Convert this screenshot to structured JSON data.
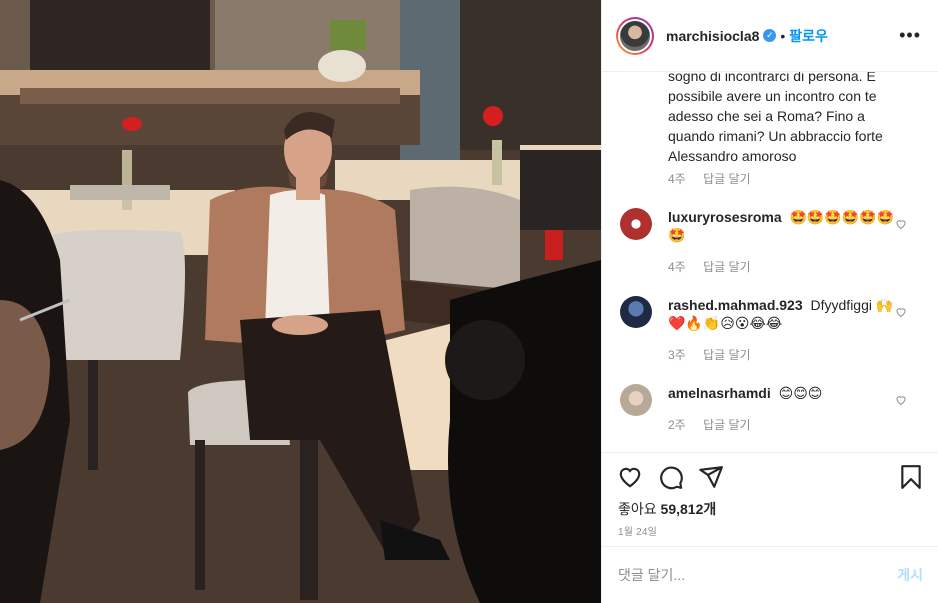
{
  "post": {
    "author": "marchisiocla8",
    "verified_glyph": "✓",
    "separator": "•",
    "follow_label": "팔로우",
    "more_label": "•••"
  },
  "comments": {
    "first": {
      "text": "sogno di incontrarci di persona. E possibile avere un incontro con te adesso che sei a Roma? Fino a quando rimani? Un abbraccio forte Alessandro amoroso",
      "time": "4주",
      "reply_label": "답글 달기"
    },
    "items": [
      {
        "user": "luxuryrosesroma",
        "text": "🤩🤩🤩🤩🤩🤩🤩",
        "time": "4주",
        "reply_label": "답글 달기",
        "avatar_color": "#b03030"
      },
      {
        "user": "rashed.mahmad.923",
        "text": "Dfyydfiggi 🙌❤️🔥👏😥😮😂😂",
        "time": "3주",
        "reply_label": "답글 달기",
        "avatar_color": "#2b3f66"
      },
      {
        "user": "amelnasrhamdi",
        "text": "😊😊😊",
        "time": "2주",
        "reply_label": "답글 달기",
        "avatar_color": "#c9b8a8"
      }
    ]
  },
  "actions": {
    "icons": [
      "heart-icon",
      "comment-icon",
      "share-icon",
      "bookmark-icon"
    ],
    "likes_label": "좋아요",
    "likes_count": "59,812개",
    "date": "1월 24일"
  },
  "composer": {
    "placeholder": "댓글 달기...",
    "post_label": "게시"
  },
  "colors": {
    "accent": "#0095f6",
    "post_disabled": "#b2dffc",
    "muted": "#8e8e8e",
    "border": "#efefef"
  }
}
